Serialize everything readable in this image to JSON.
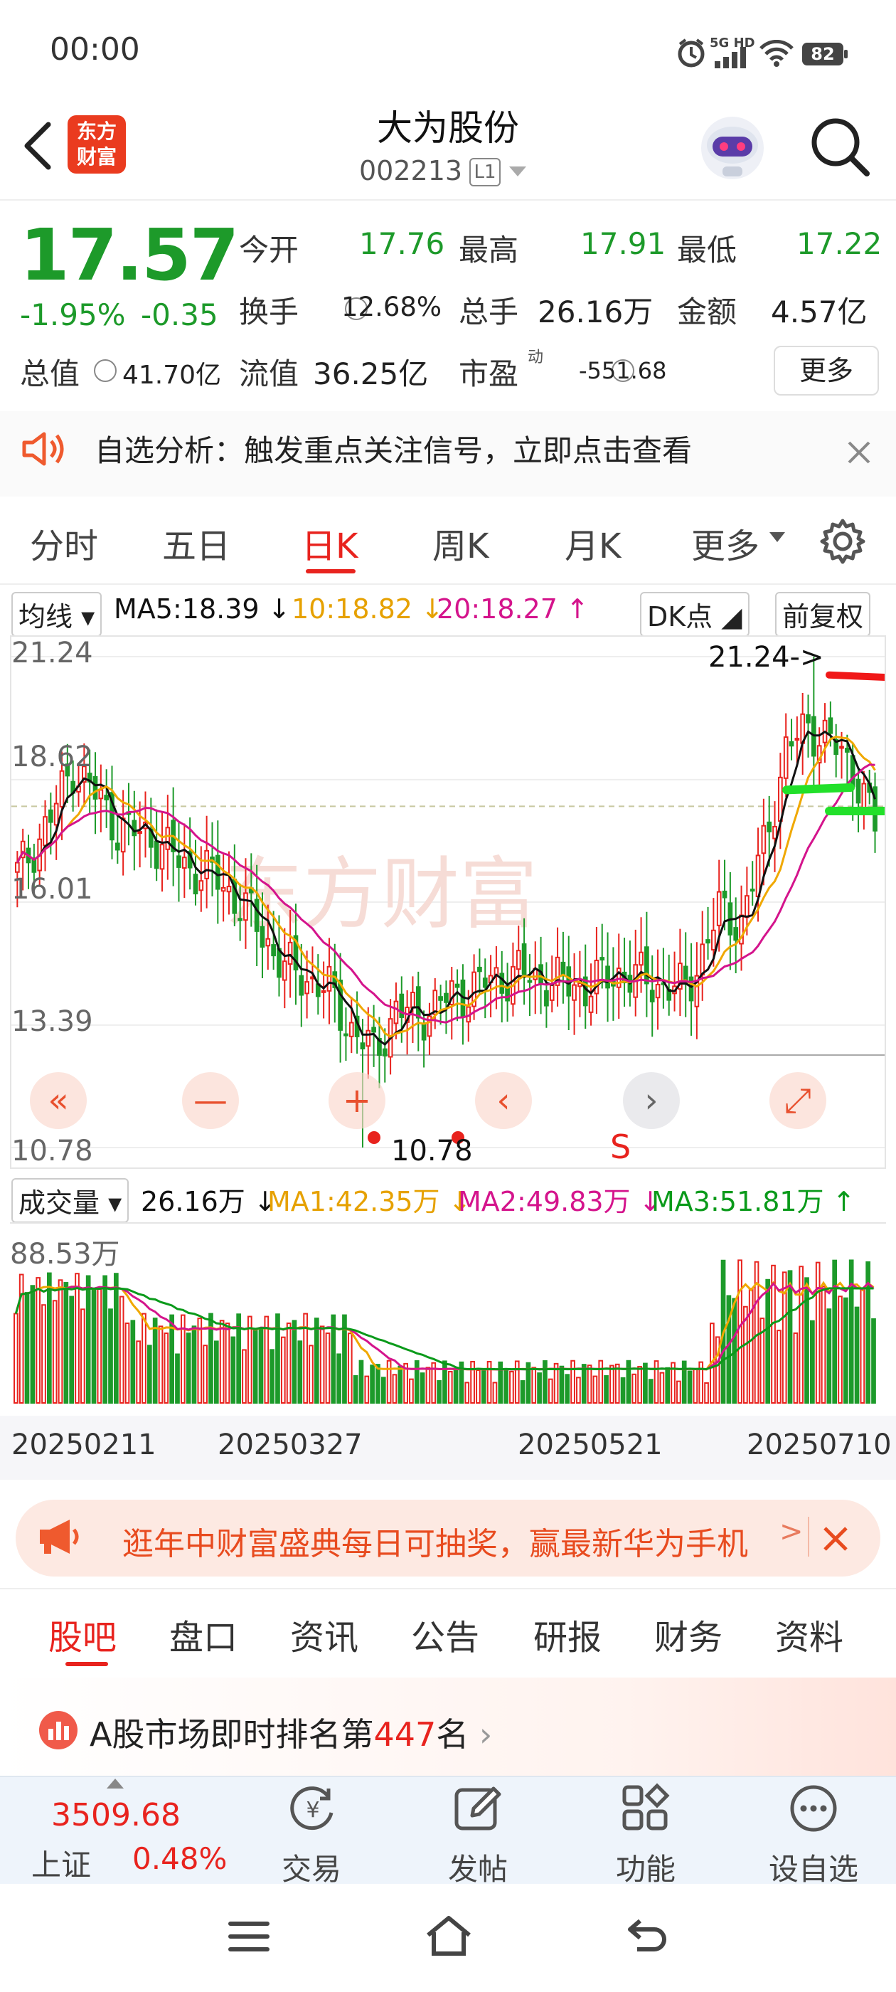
{
  "status_bar": {
    "time": "00:00",
    "network": "5G HD",
    "battery": "82"
  },
  "header": {
    "logo_text": "东方财富",
    "title": "大为股份",
    "code": "002213",
    "level": "L1"
  },
  "quote": {
    "price": "17.57",
    "change_pct": "-1.95%",
    "change_abs": "-0.35",
    "open_label": "今开",
    "open": "17.76",
    "high_label": "最高",
    "high": "17.91",
    "low_label": "最低",
    "low": "17.22",
    "turnover_label": "换手",
    "turnover": "12.68%",
    "volume_label": "总手",
    "volume": "26.16万",
    "amount_label": "金额",
    "amount": "4.57亿",
    "mktcap_label": "总值",
    "mktcap": "41.70亿",
    "float_label": "流值",
    "float_cap": "36.25亿",
    "pe_label": "市盈",
    "pe_sup": "动",
    "pe": "-551.68",
    "more_label": "更多"
  },
  "notice": {
    "text": "自选分析：触发重点关注信号，立即点击查看"
  },
  "chart_tabs": [
    {
      "label": "分时"
    },
    {
      "label": "五日"
    },
    {
      "label": "日K"
    },
    {
      "label": "周K"
    },
    {
      "label": "月K"
    },
    {
      "label": "更多"
    }
  ],
  "ma_row": {
    "selector": "均线",
    "ma5": "MA5:18.39 ↓",
    "ma10": "10:18.82 ↓",
    "ma20": "20:18.27 ↑",
    "dk_label": "DK点",
    "adjust_label": "前复权"
  },
  "kline": {
    "y_labels": [
      "21.24",
      "18.62",
      "16.01",
      "13.39",
      "10.78"
    ],
    "max_marker": "21.24->",
    "min_marker": "10.78",
    "signal_letter": "S",
    "watermark": "东方财富",
    "controls": {
      "fast_back": "«",
      "zoom_out": "—",
      "zoom_in": "+",
      "prev": "‹",
      "next": "›",
      "fullscreen": "⤢"
    }
  },
  "volume_row": {
    "selector": "成交量",
    "vol": "26.16万 ↓",
    "ma1": "MA1:42.35万 ↓",
    "ma2": "MA2:49.83万 ↓",
    "ma3": "MA3:51.81万 ↑",
    "max_label": "88.53万"
  },
  "x_labels": [
    "20250211",
    "20250327",
    "20250521",
    "20250710"
  ],
  "colors": {
    "up": "#e8231e",
    "down": "#1d9a2a",
    "ma5": "#111111",
    "ma10": "#f0a800",
    "ma20": "#d4148c",
    "ma3": "#0a9a1a"
  },
  "banner": {
    "text": "逛年中财富盛典每日可抽奖，赢最新华为手机"
  },
  "sub_tabs": [
    {
      "label": "股吧"
    },
    {
      "label": "盘口"
    },
    {
      "label": "资讯"
    },
    {
      "label": "公告"
    },
    {
      "label": "研报"
    },
    {
      "label": "财务"
    },
    {
      "label": "资料"
    }
  ],
  "rank": {
    "prefix": "A股市场即时排名第",
    "number": "447",
    "suffix": "名"
  },
  "bottom_bar": {
    "index_value": "3509.68",
    "index_name": "上证",
    "index_change": "0.48%",
    "items": [
      {
        "label": "交易",
        "icon": "yuan-icon"
      },
      {
        "label": "发帖",
        "icon": "edit-icon"
      },
      {
        "label": "功能",
        "icon": "grid-icon"
      },
      {
        "label": "设自选",
        "icon": "more-icon"
      }
    ]
  },
  "chart_data": {
    "type": "candlestick",
    "y_axis_ticks": [
      21.24,
      18.62,
      16.01,
      13.39,
      10.78
    ],
    "ylim": [
      10.78,
      21.24
    ],
    "x_tick_labels": [
      "20250211",
      "20250327",
      "20250521",
      "20250710"
    ],
    "last_close": 17.57,
    "period_high": 21.24,
    "period_low": 10.78,
    "ma": {
      "MA5": 18.39,
      "MA10": 18.82,
      "MA20": 18.27
    },
    "volume": {
      "max": "88.53万",
      "last": "26.16万",
      "MA1": "42.35万",
      "MA2": "49.83万",
      "MA3": "51.81万"
    }
  }
}
